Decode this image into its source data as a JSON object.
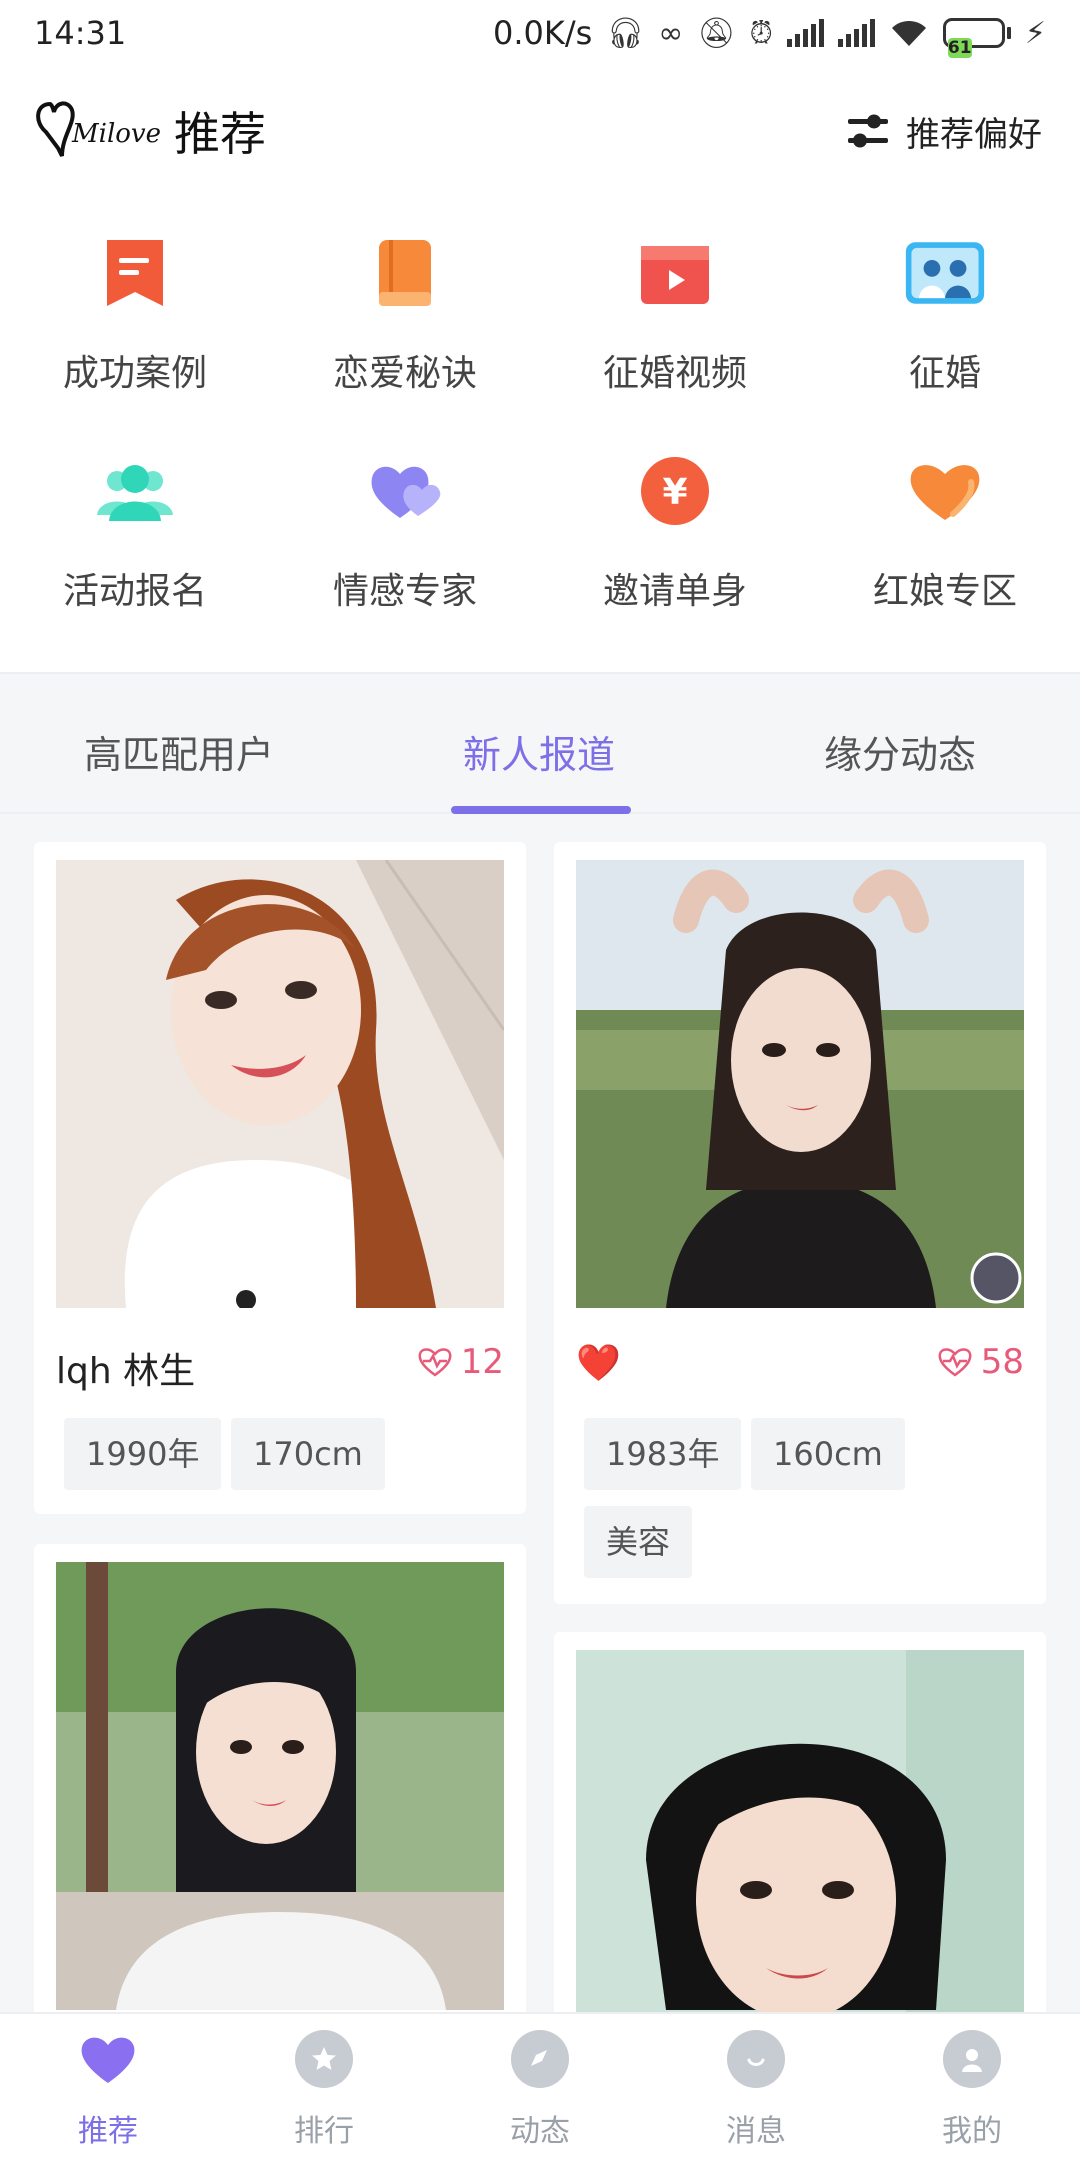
{
  "status_bar": {
    "time": "14:31",
    "net_speed": "0.0K/s",
    "battery": "61"
  },
  "header": {
    "logo_text": "Milove",
    "title": "推荐",
    "preference_label": "推荐偏好"
  },
  "categories": [
    {
      "label": "成功案例",
      "icon": "bookmark-icon",
      "color": "#f25b3a"
    },
    {
      "label": "恋爱秘诀",
      "icon": "book-icon",
      "color": "#f7893a"
    },
    {
      "label": "征婚视频",
      "icon": "video-icon",
      "color": "#f0524e"
    },
    {
      "label": "征婚",
      "icon": "couple-photo-icon",
      "color": "#3ab6f2"
    },
    {
      "label": "活动报名",
      "icon": "group-icon",
      "color": "#2fd6b8"
    },
    {
      "label": "情感专家",
      "icon": "double-heart-icon",
      "color": "#8d86f2"
    },
    {
      "label": "邀请单身",
      "icon": "yuan-coin-icon",
      "color": "#f3603e"
    },
    {
      "label": "红娘专区",
      "icon": "heart-icon",
      "color": "#f7893a"
    }
  ],
  "tabs": [
    {
      "label": "高匹配用户",
      "active": false
    },
    {
      "label": "新人报道",
      "active": true
    },
    {
      "label": "缘分动态",
      "active": false
    }
  ],
  "cards": [
    {
      "name": "lqh 林生",
      "likes": "12",
      "tags": [
        "1990年",
        "170cm"
      ]
    },
    {
      "name": "❤️",
      "likes": "58",
      "tags": [
        "1983年",
        "160cm",
        "美容"
      ]
    },
    {
      "name": "",
      "likes": "",
      "tags": []
    },
    {
      "name": "",
      "likes": "",
      "tags": []
    }
  ],
  "bottom_nav": [
    {
      "label": "推荐",
      "icon": "heart-icon",
      "active": true
    },
    {
      "label": "排行",
      "icon": "medal-icon",
      "active": false
    },
    {
      "label": "动态",
      "icon": "compass-icon",
      "active": false
    },
    {
      "label": "消息",
      "icon": "chat-icon",
      "active": false
    },
    {
      "label": "我的",
      "icon": "user-icon",
      "active": false
    }
  ],
  "colors": {
    "accent": "#7c6fe8",
    "like": "#e85a7a",
    "tag_bg": "#f2f3f5"
  }
}
